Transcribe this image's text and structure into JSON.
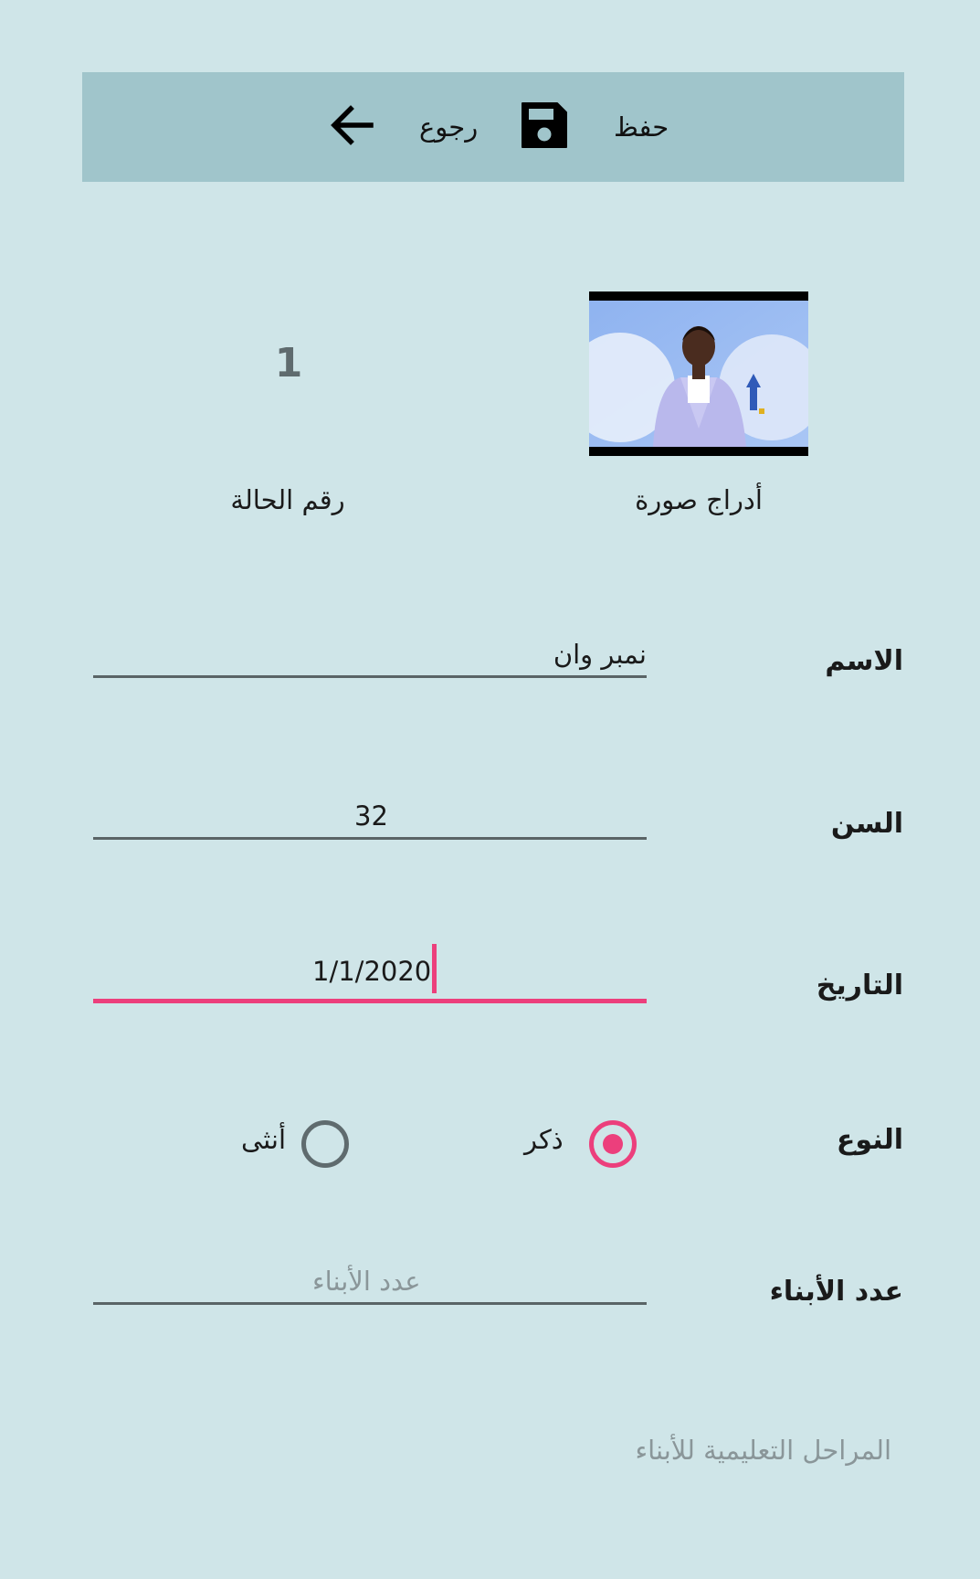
{
  "toolbar": {
    "save_label": "حفظ",
    "save_icon": "floppy-disk-icon",
    "back_label": "رجوع",
    "back_icon": "arrow-left-icon",
    "background": "#a0c5cb"
  },
  "photo": {
    "caption": "أدراج صورة"
  },
  "case": {
    "number": "1",
    "caption": "رقم الحالة"
  },
  "form": {
    "name": {
      "label": "الاسم",
      "value": "نمبر وان"
    },
    "age": {
      "label": "السن",
      "value": "32"
    },
    "date": {
      "label": "التاريخ",
      "value": "1/1/2020"
    },
    "gender": {
      "label": "النوع",
      "options": [
        {
          "label": "ذكر",
          "checked": true
        },
        {
          "label": "أنثى",
          "checked": false
        }
      ]
    },
    "children_count": {
      "label": "عدد الأبناء",
      "placeholder": "عدد الأبناء",
      "value": ""
    },
    "education_stages_hint": "المراحل التعليمية للأبناء"
  },
  "colors": {
    "background": "#cfe5e8",
    "accent": "#ec3f7c",
    "underline": "#5a6466",
    "muted": "#8a9699"
  }
}
